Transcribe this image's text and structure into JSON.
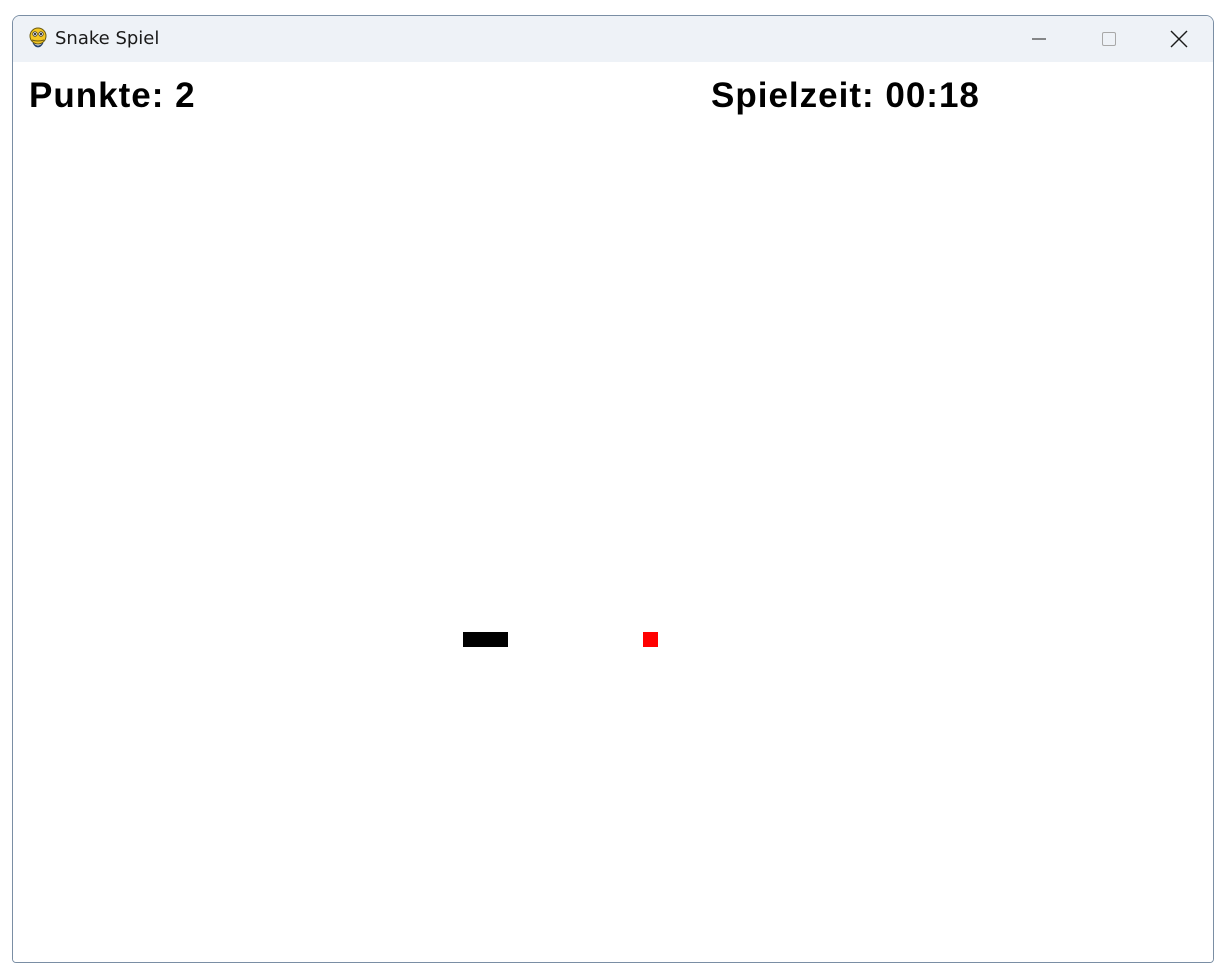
{
  "window": {
    "title": "Snake Spiel",
    "icon": "pygame-snake-icon",
    "controls": [
      "minimize-icon",
      "maximize-icon",
      "close-icon"
    ]
  },
  "hud": {
    "score_text": "Punkte: 2",
    "time_text": "Spielzeit: 00:18"
  },
  "game": {
    "background_color": "#ffffff",
    "snake_color": "#000000",
    "food_color": "#ff0000",
    "grid": {
      "cols": 80,
      "rows": 60
    },
    "snake": {
      "segments": [
        [
          30,
          38
        ],
        [
          31,
          38
        ],
        [
          32,
          38
        ]
      ]
    },
    "food": {
      "cell": [
        42,
        38
      ]
    }
  }
}
